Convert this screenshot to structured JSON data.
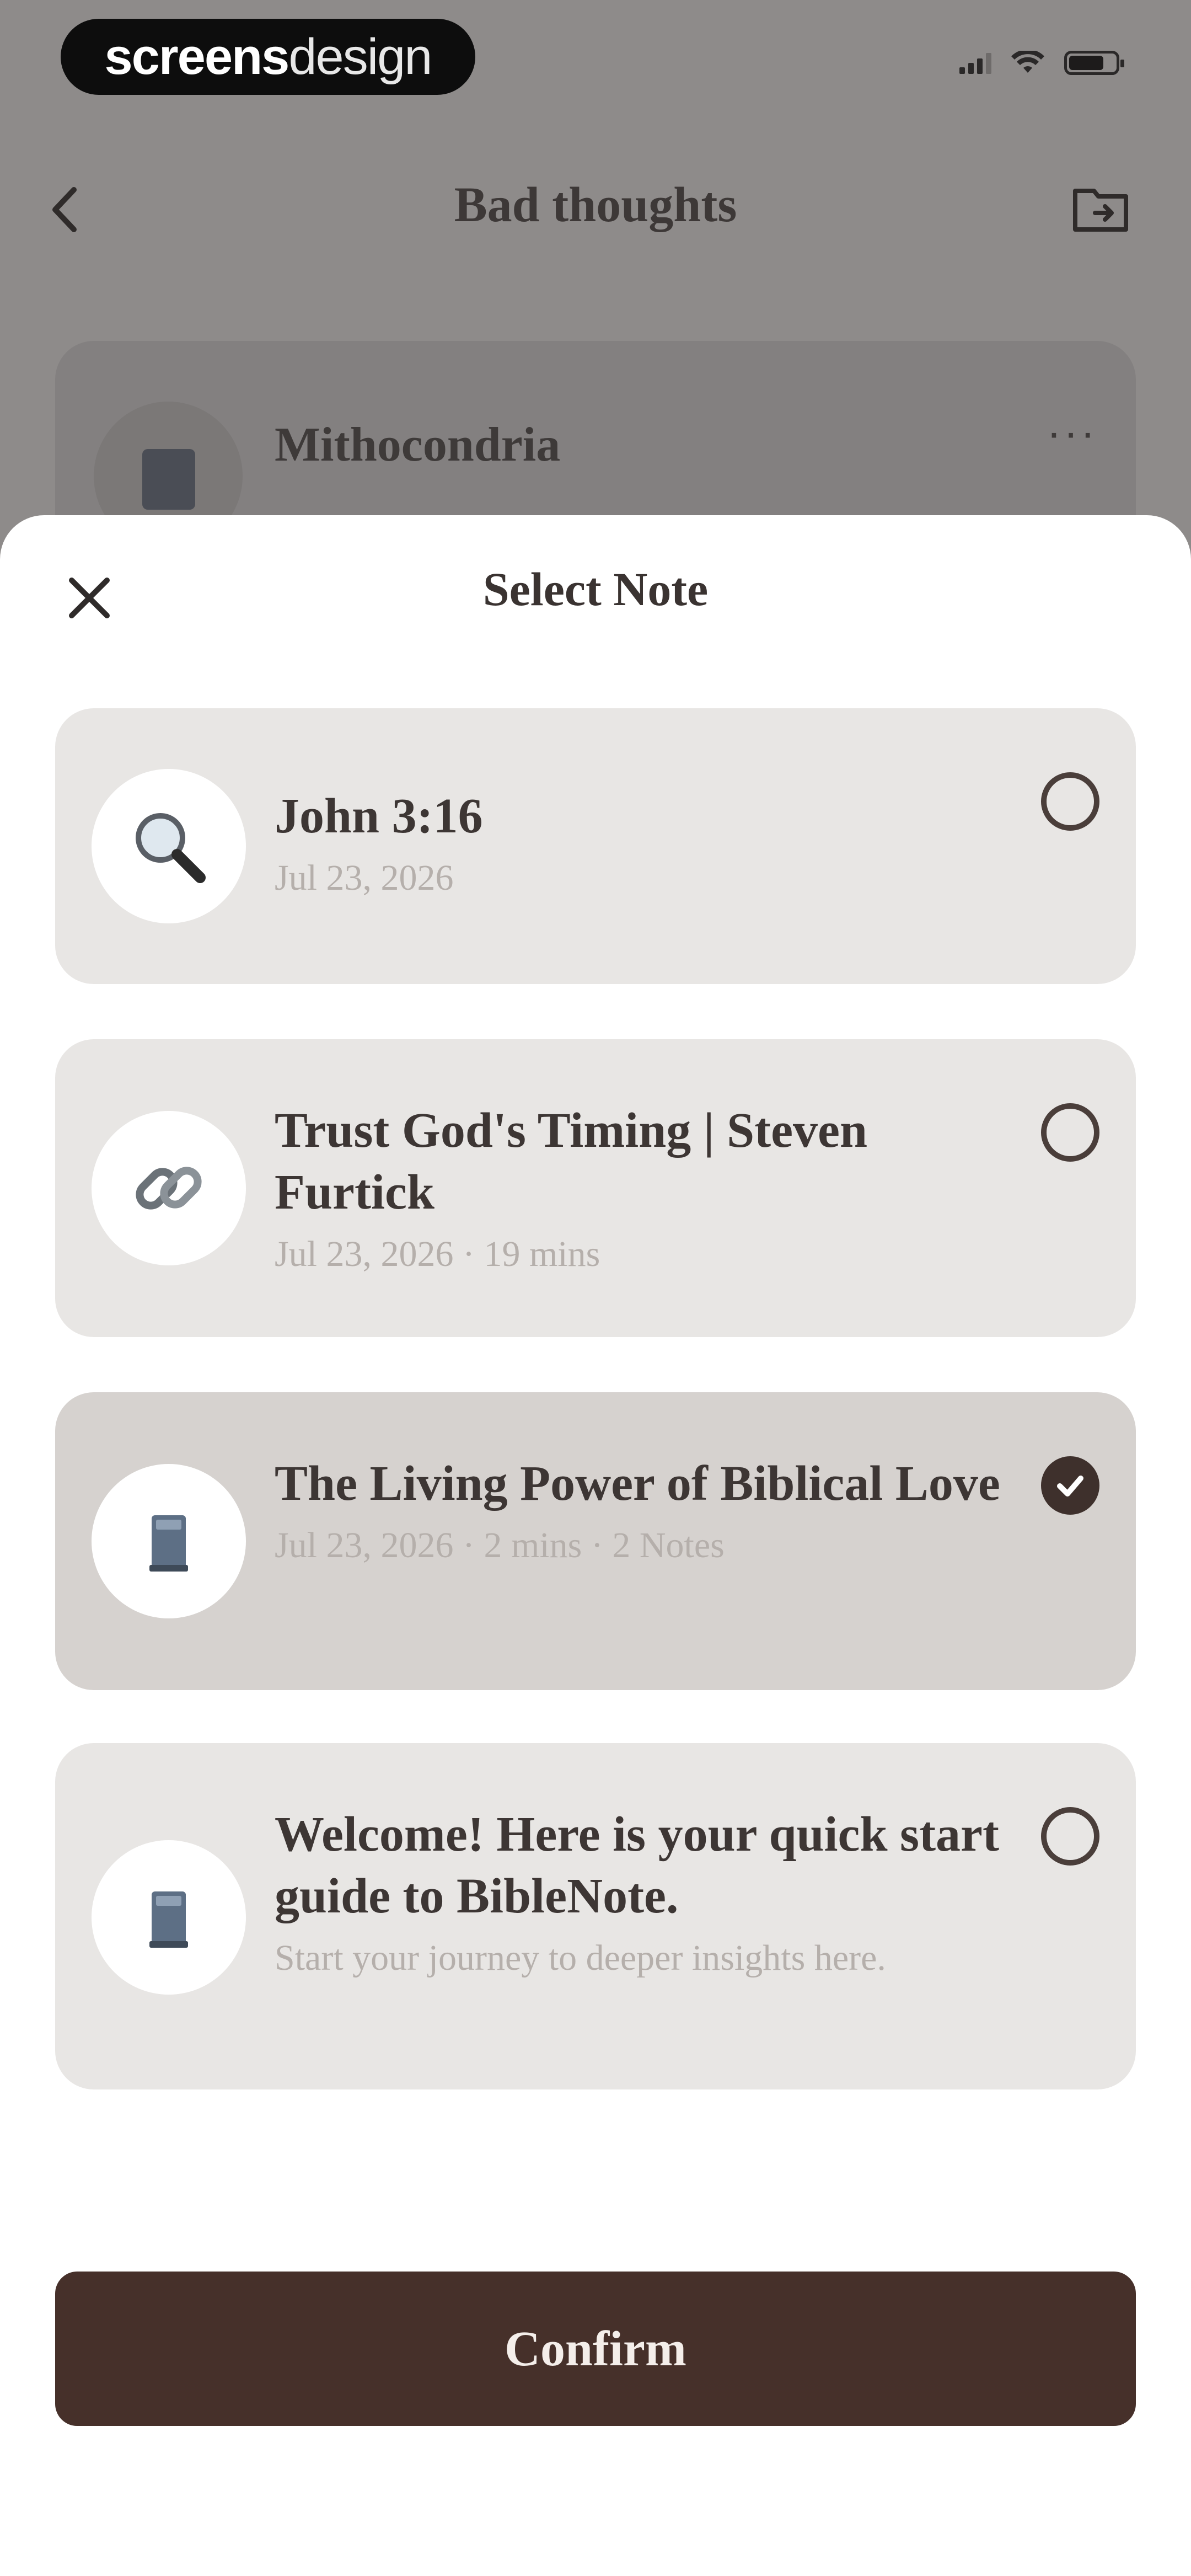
{
  "status_bar": {
    "brand_prefix": "screens",
    "brand_suffix": "design"
  },
  "background": {
    "title": "Bad thoughts",
    "card_title": "Mithocondria",
    "more_label": "···"
  },
  "sheet": {
    "title": "Select Note",
    "confirm_label": "Confirm",
    "notes": [
      {
        "title": "John 3:16",
        "meta": "Jul 23, 2026",
        "icon": "magnifier-icon",
        "selected": false
      },
      {
        "title": "Trust God's Timing | Steven Furtick",
        "meta": "Jul 23, 2026 · 19 mins",
        "icon": "link-icon",
        "selected": false
      },
      {
        "title": "The Living Power of Biblical Love",
        "meta": "Jul 23, 2026 · 2 mins · 2 Notes",
        "icon": "book-stack-icon",
        "selected": true
      },
      {
        "title": "Welcome! Here is your quick start guide to BibleNote.",
        "meta": "Start your journey to deeper insights here.",
        "icon": "book-stack-icon",
        "selected": false
      }
    ]
  },
  "colors": {
    "accent": "#46302a",
    "card": "#e8e6e4",
    "card_selected": "#d6d2cf"
  }
}
